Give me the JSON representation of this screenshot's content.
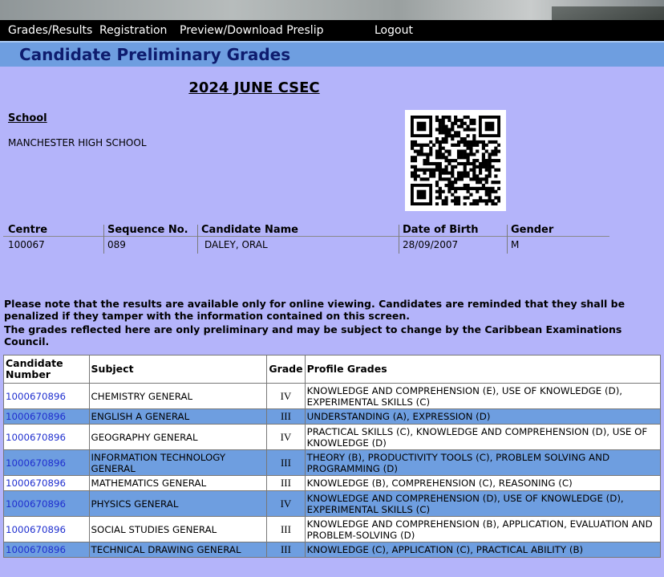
{
  "nav": {
    "items": [
      "Grades/Results",
      "Registration",
      "Preview/Download Preslip"
    ],
    "logout": "Logout"
  },
  "page_title": "Candidate Preliminary Grades",
  "exam_title": "2024 JUNE CSEC",
  "school": {
    "label": "School",
    "name": "MANCHESTER HIGH SCHOOL"
  },
  "qr_icon": "qr-code-icon",
  "candidate_info": {
    "centre_label": "Centre",
    "centre": "100067",
    "sequence_label": "Sequence No.",
    "sequence": "089",
    "name_label": "Candidate Name",
    "name": "DALEY, ORAL",
    "dob_label": "Date of Birth",
    "dob": "28/09/2007",
    "gender_label": "Gender",
    "gender": "M"
  },
  "notice": {
    "line1": "Please note that the results are available only for online viewing. Candidates are reminded that they shall be penalized if they tamper with the information contained on this screen.",
    "line2": "The grades reflected here are only preliminary and may be subject to change by the Caribbean Examinations Council."
  },
  "grades_table": {
    "headers": [
      "Candidate Number",
      "Subject",
      "Grade",
      "Profile Grades"
    ],
    "rows": [
      {
        "number": "1000670896",
        "subject": "CHEMISTRY GENERAL",
        "grade": "IV",
        "profile": "KNOWLEDGE AND COMPREHENSION (E), USE OF KNOWLEDGE (D), EXPERIMENTAL SKILLS (C)"
      },
      {
        "number": "1000670896",
        "subject": "ENGLISH A GENERAL",
        "grade": "III",
        "profile": "UNDERSTANDING (A), EXPRESSION (D)"
      },
      {
        "number": "1000670896",
        "subject": "GEOGRAPHY GENERAL",
        "grade": "IV",
        "profile": "PRACTICAL SKILLS (C), KNOWLEDGE AND COMPREHENSION (D), USE OF KNOWLEDGE (D)"
      },
      {
        "number": "1000670896",
        "subject": "INFORMATION TECHNOLOGY GENERAL",
        "grade": "III",
        "profile": "THEORY (B), PRODUCTIVITY TOOLS (C), PROBLEM SOLVING AND PROGRAMMING (D)"
      },
      {
        "number": "1000670896",
        "subject": "MATHEMATICS GENERAL",
        "grade": "III",
        "profile": "KNOWLEDGE (B), COMPREHENSION (C), REASONING (C)"
      },
      {
        "number": "1000670896",
        "subject": "PHYSICS GENERAL",
        "grade": "IV",
        "profile": "KNOWLEDGE AND COMPREHENSION (D), USE OF KNOWLEDGE (D), EXPERIMENTAL SKILLS (C)"
      },
      {
        "number": "1000670896",
        "subject": "SOCIAL STUDIES GENERAL",
        "grade": "III",
        "profile": "KNOWLEDGE AND COMPREHENSION (B), APPLICATION, EVALUATION AND PROBLEM-SOLVING (D)"
      },
      {
        "number": "1000670896",
        "subject": "TECHNICAL DRAWING GENERAL",
        "grade": "III",
        "profile": "KNOWLEDGE (C), APPLICATION (C), PRACTICAL ABILITY (B)"
      }
    ]
  },
  "colors": {
    "page_bg": "#b4b4fa",
    "title_bar": "#6e9ee0",
    "title_text": "#0e1c6e",
    "link": "#1f2fcf"
  }
}
